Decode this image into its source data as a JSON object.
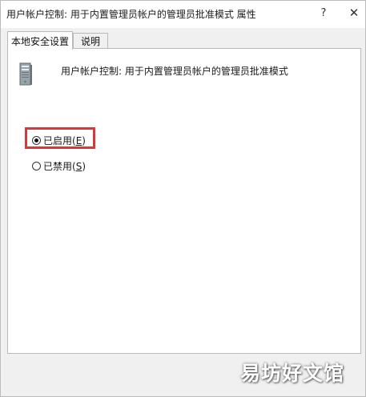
{
  "window": {
    "title": "用户帐户控制: 用于内置管理员帐户的管理员批准模式 属性",
    "help_label": "?",
    "close_label": "✕"
  },
  "tabs": [
    {
      "label": "本地安全设置",
      "active": true
    },
    {
      "label": "说明",
      "active": false
    }
  ],
  "policy": {
    "icon": "server-computer-icon",
    "name": "用户帐户控制: 用于内置管理员帐户的管理员批准模式"
  },
  "options": {
    "enabled": {
      "prefix": "已启用(",
      "key": "E",
      "suffix": ")",
      "selected": true
    },
    "disabled": {
      "prefix": "已禁用(",
      "key": "S",
      "suffix": ")",
      "selected": false
    }
  },
  "highlight_color": "#d23a3c",
  "watermark": "易坊好文馆"
}
